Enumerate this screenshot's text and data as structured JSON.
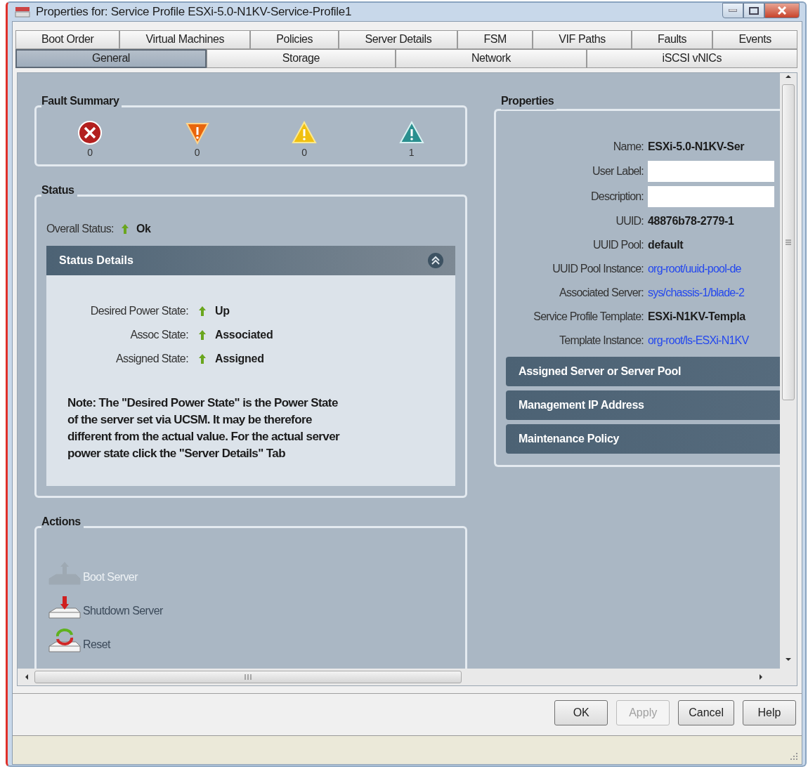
{
  "window": {
    "title": "Properties for: Service Profile ESXi-5.0-N1KV-Service-Profile1"
  },
  "tab_rows": [
    [
      {
        "label": "Boot Order",
        "selected": false
      },
      {
        "label": "Virtual Machines",
        "selected": false
      },
      {
        "label": "Policies",
        "selected": false
      },
      {
        "label": "Server Details",
        "selected": false
      },
      {
        "label": "FSM",
        "selected": false
      },
      {
        "label": "VIF Paths",
        "selected": false
      },
      {
        "label": "Faults",
        "selected": false
      },
      {
        "label": "Events",
        "selected": false
      }
    ],
    [
      {
        "label": "General",
        "selected": true
      },
      {
        "label": "Storage",
        "selected": false
      },
      {
        "label": "Network",
        "selected": false
      },
      {
        "label": "iSCSI vNICs",
        "selected": false
      }
    ]
  ],
  "fault_summary": {
    "title": "Fault Summary",
    "items": [
      {
        "kind": "critical",
        "count": "0"
      },
      {
        "kind": "major",
        "count": "0"
      },
      {
        "kind": "minor",
        "count": "0"
      },
      {
        "kind": "warning",
        "count": "1"
      }
    ]
  },
  "status": {
    "title": "Status",
    "overall_label": "Overall Status:",
    "overall_value": "Ok",
    "details": {
      "title": "Status Details",
      "expanded": true,
      "rows": [
        {
          "label": "Desired Power State:",
          "value": "Up"
        },
        {
          "label": "Assoc State:",
          "value": "Associated"
        },
        {
          "label": "Assigned State:",
          "value": "Assigned"
        }
      ],
      "note": "Note: The \"Desired Power State\" is the Power State of the server set via UCSM. It may be therefore different from the actual value. For the actual server power state click the \"Server Details\" Tab"
    }
  },
  "actions": {
    "title": "Actions",
    "items": [
      {
        "kind": "boot",
        "label": "Boot Server",
        "disabled": true
      },
      {
        "kind": "shutdown",
        "label": "Shutdown Server",
        "disabled": false
      },
      {
        "kind": "reset",
        "label": "Reset",
        "disabled": false
      }
    ]
  },
  "properties": {
    "title": "Properties",
    "rows": [
      {
        "kind": "text",
        "label": "Name:",
        "value": "ESXi-5.0-N1KV-Ser"
      },
      {
        "kind": "field",
        "label": "User Label:"
      },
      {
        "kind": "field",
        "label": "Description:"
      },
      {
        "kind": "text",
        "label": "UUID:",
        "value": "48876b78-2779-1"
      },
      {
        "kind": "text",
        "label": "UUID Pool:",
        "value": "default"
      },
      {
        "kind": "link",
        "label": "UUID Pool Instance:",
        "value": "org-root/uuid-pool-de"
      },
      {
        "kind": "link",
        "label": "Associated Server:",
        "value": "sys/chassis-1/blade-2"
      },
      {
        "kind": "text",
        "label": "Service Profile Template:",
        "value": "ESXi-N1KV-Templa"
      },
      {
        "kind": "link",
        "label": "Template Instance:",
        "value": "org-root/ls-ESXi-N1KV"
      }
    ],
    "sections": [
      {
        "title": "Assigned Server or Server Pool",
        "expanded": false
      },
      {
        "title": "Management IP Address",
        "expanded": false
      },
      {
        "title": "Maintenance Policy",
        "expanded": false
      }
    ]
  },
  "buttons": [
    {
      "label": "OK",
      "disabled": false
    },
    {
      "label": "Apply",
      "disabled": true
    },
    {
      "label": "Cancel",
      "disabled": false
    },
    {
      "label": "Help",
      "disabled": false
    }
  ]
}
